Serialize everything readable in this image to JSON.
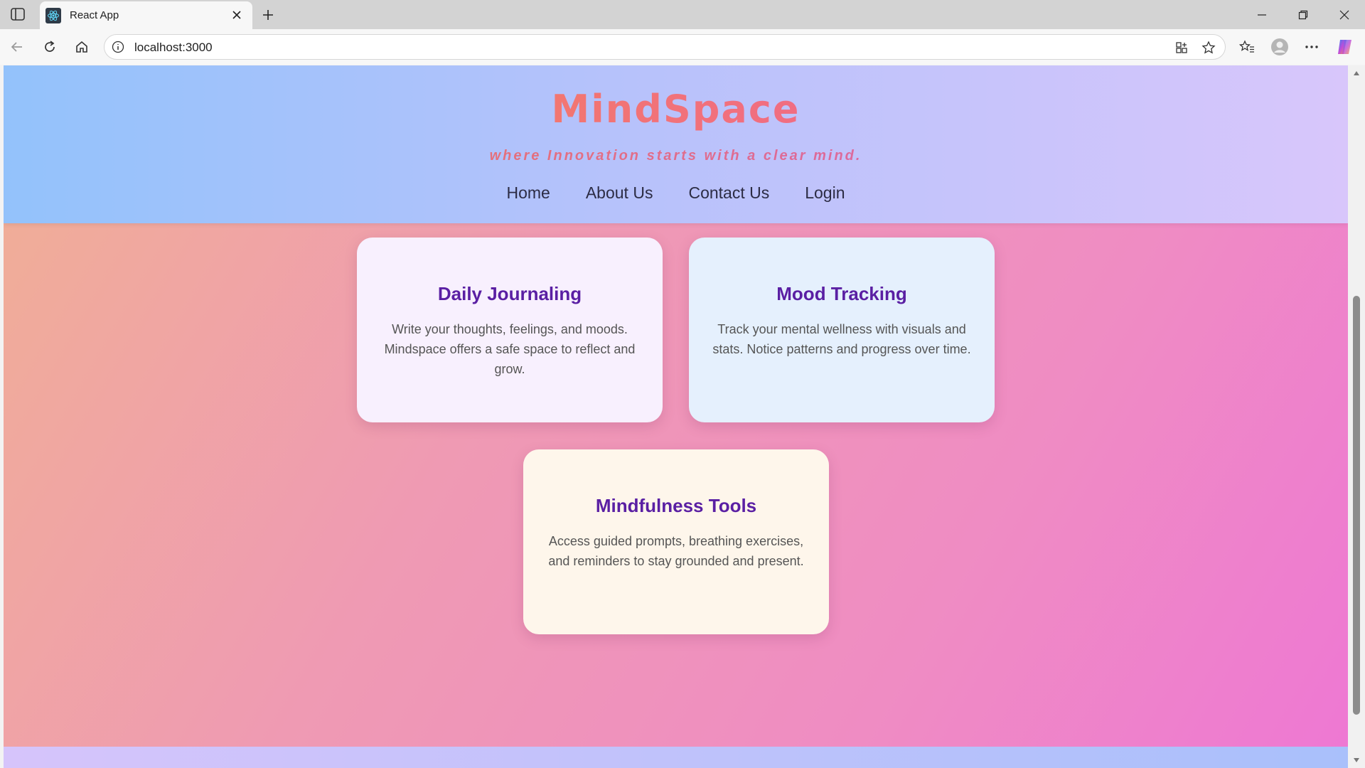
{
  "browser": {
    "tab_title": "React App",
    "url": "localhost:3000"
  },
  "header": {
    "brand": "MindSpace",
    "tagline": "where Innovation starts with a clear mind.",
    "nav": [
      {
        "label": "Home"
      },
      {
        "label": "About Us"
      },
      {
        "label": "Contact Us"
      },
      {
        "label": "Login"
      }
    ]
  },
  "cards": [
    {
      "title": "Daily Journaling",
      "text": "Write your thoughts, feelings, and moods. Mindspace offers a safe space to reflect and grow."
    },
    {
      "title": "Mood Tracking",
      "text": "Track your mental wellness with visuals and stats. Notice patterns and progress over time."
    },
    {
      "title": "Mindfulness Tools",
      "text": "Access guided prompts, breathing exercises, and reminders to stay grounded and present."
    }
  ],
  "colors": {
    "brand_gradient_start": "#f4894a",
    "brand_gradient_end": "#ee5aa9",
    "card_title": "#5a1fa3"
  },
  "icons": {
    "favicon": "react-logo-icon",
    "sidebar": "sidebar-toggle-icon"
  }
}
